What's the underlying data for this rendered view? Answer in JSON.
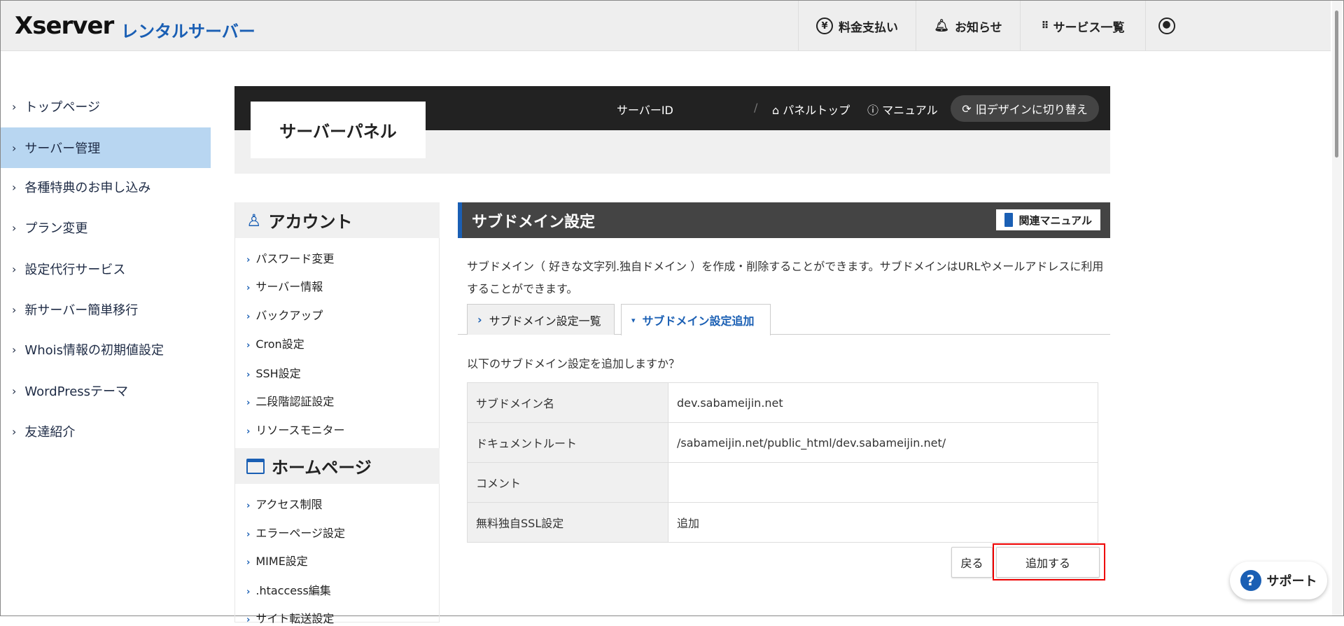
{
  "header": {
    "logo": "Xserver",
    "logo_sub": "レンタルサーバー",
    "nav": [
      {
        "icon": "yen-icon",
        "label": "料金支払い"
      },
      {
        "icon": "bell-icon",
        "label": "お知らせ"
      },
      {
        "icon": "grid-icon",
        "label": "サービス一覧"
      },
      {
        "icon": "user-icon",
        "label": ""
      }
    ]
  },
  "sidebar": {
    "items": [
      {
        "label": "トップページ"
      },
      {
        "label": "サーバー管理",
        "active": true
      },
      {
        "label": "各種特典のお申し込み"
      },
      {
        "label": "プラン変更"
      },
      {
        "label": "設定代行サービス"
      },
      {
        "label": "新サーバー簡単移行"
      },
      {
        "label": "Whois情報の初期値設定"
      },
      {
        "label": "WordPressテーマ"
      },
      {
        "label": "友達紹介"
      }
    ]
  },
  "panel": {
    "title": "サーバーパネル",
    "server_id": "サーバーID",
    "panel_top": "パネルトップ",
    "manual": "マニュアル",
    "old_design": "旧デザインに切り替え"
  },
  "menu": {
    "account": {
      "title": "アカウント",
      "items": [
        "パスワード変更",
        "サーバー情報",
        "バックアップ",
        "Cron設定",
        "SSH設定",
        "二段階認証設定",
        "リソースモニター"
      ]
    },
    "homepage": {
      "title": "ホームページ",
      "items": [
        "アクセス制限",
        "エラーページ設定",
        "MIME設定",
        ".htaccess編集",
        "サイト転送設定"
      ]
    }
  },
  "main": {
    "title": "サブドメイン設定",
    "manual_btn": "関連マニュアル",
    "description": "サブドメイン（ 好きな文字列.独自ドメイン ）を作成・削除することができます。サブドメインはURLやメールアドレスに利用することができます。",
    "tabs": [
      {
        "label": "サブドメイン設定一覧"
      },
      {
        "label": "サブドメイン設定追加",
        "active": true
      }
    ],
    "question": "以下のサブドメイン設定を追加しますか？",
    "rows": [
      {
        "label": "サブドメイン名",
        "value": "dev.sabameijin.net"
      },
      {
        "label": "ドキュメントルート",
        "value": "/sabameijin.net/public_html/dev.sabameijin.net/"
      },
      {
        "label": "コメント",
        "value": ""
      },
      {
        "label": "無料独自SSL設定",
        "value": "追加"
      }
    ],
    "back_btn": "戻る",
    "add_btn": "追加する"
  },
  "support": {
    "label": "サポート"
  },
  "colors": {
    "accent": "#1a5fb4",
    "highlight": "#b8d6f1",
    "dark": "#222222",
    "red_outline": "#ee0000"
  }
}
